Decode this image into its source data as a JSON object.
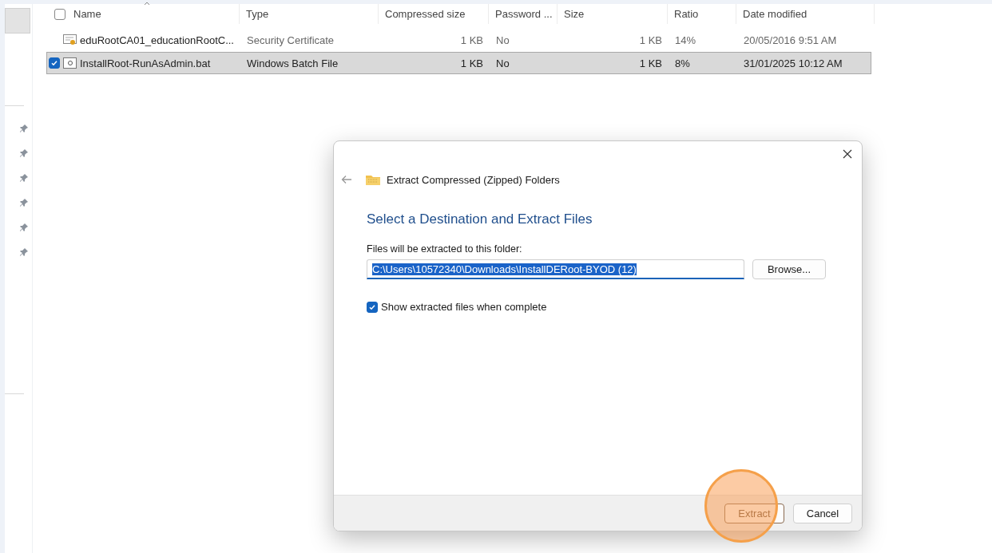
{
  "table": {
    "select_all": {
      "checked": false
    },
    "columns": [
      "Name",
      "Type",
      "Compressed size",
      "Password ...",
      "Size",
      "Ratio",
      "Date modified"
    ],
    "rows": [
      {
        "kind": "certificate",
        "selected": false,
        "cells": [
          "eduRootCA01_educationRootC...",
          "Security Certificate",
          "1 KB",
          "No",
          "1 KB",
          "14%",
          "20/05/2016 9:51 AM"
        ]
      },
      {
        "kind": "batch",
        "selected": true,
        "cells": [
          "InstallRoot-RunAsAdmin.bat",
          "Windows Batch File",
          "1 KB",
          "No",
          "1 KB",
          "8%",
          "31/01/2025 10:12 AM"
        ]
      }
    ]
  },
  "dialog": {
    "title": "Extract Compressed (Zipped) Folders",
    "heading": "Select a Destination and Extract Files",
    "folder_label": "Files will be extracted to this folder:",
    "path": {
      "value": "C:\\Users\\10572340\\Downloads\\InstallDERoot-BYOD (12)",
      "selected": true
    },
    "browse": "Browse...",
    "show_files": {
      "label": "Show extracted files when complete",
      "checked": true
    },
    "buttons": [
      {
        "label": "Extract",
        "highlighted": true
      },
      {
        "label": "Cancel",
        "highlighted": false
      }
    ]
  }
}
